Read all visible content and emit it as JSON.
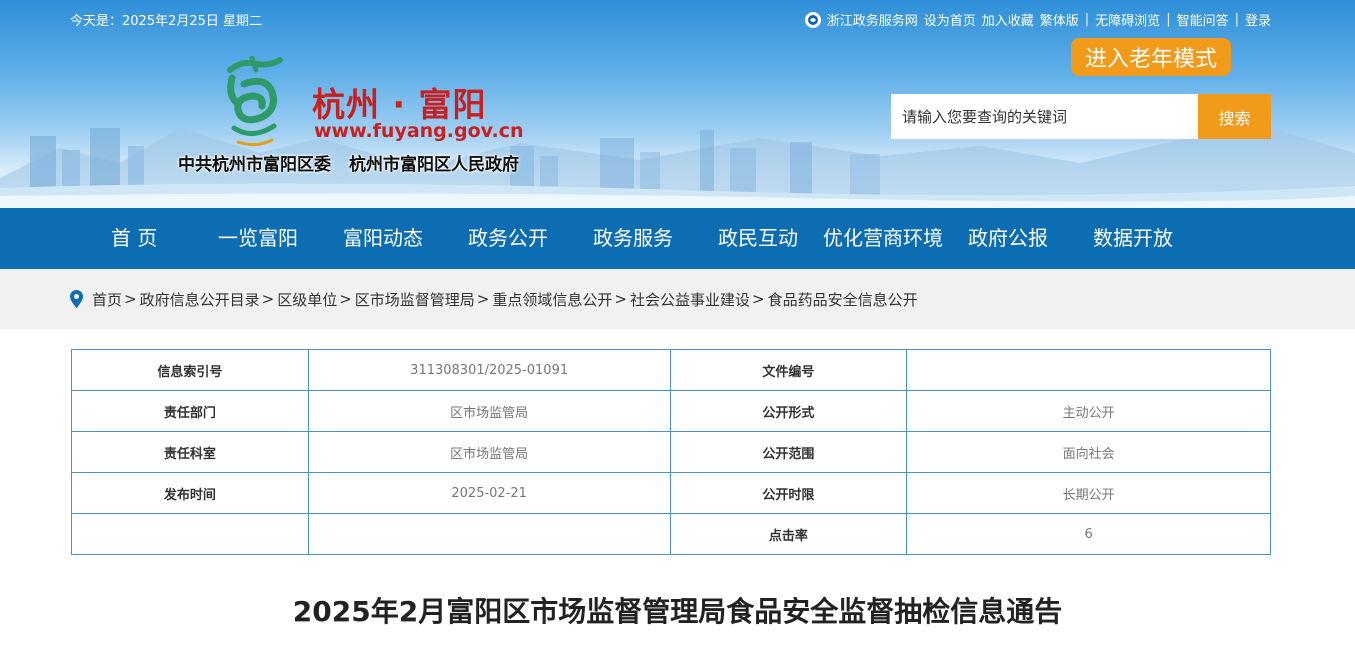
{
  "topbar": {
    "date": "今天是：2025年2月25日 星期二",
    "zj_service": "浙江政务服务网",
    "set_home": "设为首页",
    "add_fav": "加入收藏",
    "traditional": "繁体版",
    "accessible": "无障碍浏览",
    "smart_qa": "智能问答",
    "login": "登录",
    "divider": "|"
  },
  "senior_mode": "进入老年模式",
  "brand": {
    "name": "杭州 · 富阳",
    "url": "www.fuyang.gov.cn",
    "org1": "中共杭州市富阳区委",
    "org2": "杭州市富阳区人民政府",
    "colors": {
      "red": "#c8201e",
      "logo_green": "#2e9a6a"
    }
  },
  "search": {
    "placeholder": "请输入您要查询的关键词",
    "button": "搜索"
  },
  "nav": [
    "首 页",
    "一览富阳",
    "富阳动态",
    "政务公开",
    "政务服务",
    "政民互动",
    "优化营商环境",
    "政府公报",
    "数据开放"
  ],
  "breadcrumb": {
    "items": [
      "首页",
      "政府信息公开目录",
      "区级单位",
      "区市场监督管理局",
      "重点领域信息公开",
      "社会公益事业建设",
      "食品药品安全信息公开"
    ],
    "sep": ">"
  },
  "info_table": {
    "rows": [
      [
        "信息索引号",
        "311308301/2025-01091",
        "文件编号",
        ""
      ],
      [
        "责任部门",
        "区市场监管局",
        "公开形式",
        "主动公开"
      ],
      [
        "责任科室",
        "区市场监管局",
        "公开范围",
        "面向社会"
      ],
      [
        "发布时间",
        "2025-02-21",
        "公开时限",
        "长期公开"
      ],
      [
        "",
        "",
        "点击率",
        "6"
      ]
    ]
  },
  "article_title": "2025年2月富阳区市场监督管理局食品安全监督抽检信息通告",
  "colors": {
    "nav": "#0d6db3",
    "accent": "#f29a1a",
    "table_border": "#4a93c5"
  }
}
